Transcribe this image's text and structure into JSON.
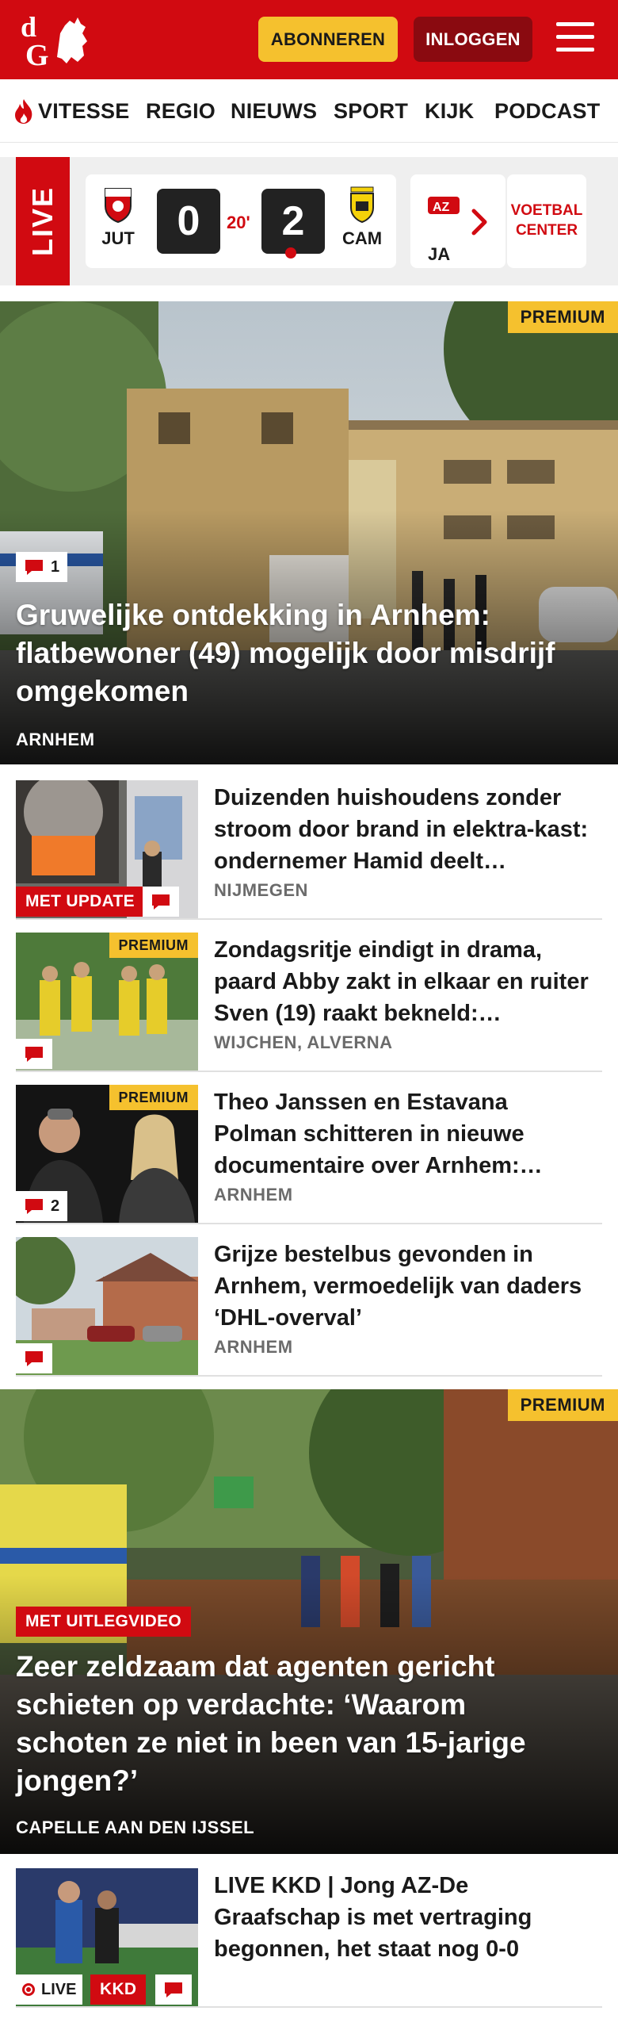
{
  "header": {
    "logo_text": "dG",
    "subscribe_label": "ABONNEREN",
    "login_label": "INLOGGEN",
    "colors": {
      "brand": "#d10a11",
      "accent": "#f5c12e"
    }
  },
  "nav": {
    "items": [
      "VITESSE",
      "REGIO",
      "NIEUWS",
      "SPORT",
      "KIJK",
      "PODCAST"
    ]
  },
  "scores": {
    "live_label": "LIVE",
    "match": {
      "home_code": "JUT",
      "away_code": "CAM",
      "home_score": "0",
      "away_score": "2",
      "minute": "20'"
    },
    "next_match_code": "JA",
    "voetbal_center": "VOETBAL CENTER"
  },
  "hero": {
    "badge": "PREMIUM",
    "comments": "1",
    "title": "Gruwelijke ontdekking in Arnhem: flatbewoner (49) mogelijk door misdrijf omgekomen",
    "location": "ARNHEM"
  },
  "articles": [
    {
      "label": "MET UPDATE",
      "title": "Duizenden huishoudens zonder stroom door brand in elektra-kast: ondernemer Hamid deelt…",
      "location": "NIJMEGEN",
      "comments": ""
    },
    {
      "badge": "PREMIUM",
      "title": "Zondagsritje eindigt in drama, paard Abby zakt in elkaar en ruiter Sven (19) raakt bekneld:…",
      "location": "WIJCHEN, ALVERNA",
      "comments": ""
    },
    {
      "badge": "PREMIUM",
      "title": "Theo Janssen en Estavana Polman schitteren in nieuwe documentaire over Arnhem:…",
      "location": "ARNHEM",
      "comments": "2"
    },
    {
      "title": "Grijze bestelbus gevonden in Arnhem, vermoedelijk van daders ‘DHL-overval’",
      "location": "ARNHEM",
      "comments": ""
    }
  ],
  "hero2": {
    "badge": "PREMIUM",
    "label": "MET UITLEGVIDEO",
    "title": "Zeer zeldzaam dat agenten gericht schieten op verdachte: ‘Waarom schoten ze niet in been van 15-jarige jongen?’",
    "location": "CAPELLE AAN DEN IJSSEL"
  },
  "live_article": {
    "live_label": "LIVE",
    "tag": "KKD",
    "title": "LIVE KKD | Jong AZ-De Graafschap is met vertraging begonnen, het staat nog 0-0"
  }
}
